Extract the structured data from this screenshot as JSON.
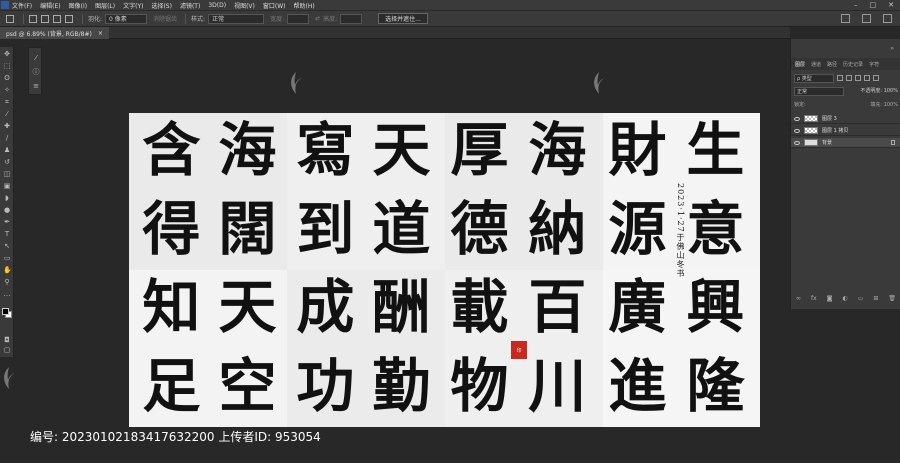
{
  "menubar": {
    "items": [
      "文件(F)",
      "编辑(E)",
      "图像(I)",
      "图层(L)",
      "文字(Y)",
      "选择(S)",
      "滤镜(T)",
      "3D(D)",
      "视图(V)",
      "窗口(W)",
      "帮助(H)"
    ],
    "window_controls": [
      "–",
      "□",
      "✕"
    ]
  },
  "options": {
    "feather_label": "羽化:",
    "feather_value": "0 像素",
    "antialias_label": "消除锯齿",
    "style_label": "样式:",
    "style_value": "正常",
    "width_label": "宽度:",
    "height_label": "高度:",
    "select_mask_button": "选择并遮住..."
  },
  "document": {
    "tab_title": "psd @ 6.89% (背景, RGB/8#)",
    "tab_close": "×"
  },
  "toolbar": {
    "tools": [
      "move-icon",
      "marquee-icon",
      "lasso-icon",
      "magic-wand-icon",
      "crop-icon",
      "eyedropper-icon",
      "healing-icon",
      "brush-icon",
      "stamp-icon",
      "history-brush-icon",
      "eraser-icon",
      "gradient-icon",
      "blur-icon",
      "dodge-icon",
      "pen-icon",
      "type-icon",
      "path-select-icon",
      "shape-icon",
      "hand-icon",
      "zoom-icon",
      "more-tools-icon"
    ],
    "tool_glyphs": [
      "✥",
      "⬚",
      "ʘ",
      "✧",
      "⌗",
      "⁄",
      "✚",
      "∕",
      "♟",
      "↺",
      "◫",
      "▣",
      "◗",
      "●",
      "✒",
      "T",
      "↖",
      "▭",
      "✋",
      "⚲",
      "…"
    ]
  },
  "calligraphy": {
    "row1": [
      "含",
      "海",
      "寫",
      "天",
      "厚",
      "海",
      "財",
      "生"
    ],
    "row2": [
      "得",
      "闊",
      "到",
      "道",
      "德",
      "納",
      "源",
      "意"
    ],
    "row3": [
      "知",
      "天",
      "成",
      "酬",
      "載",
      "百",
      "廣",
      "興"
    ],
    "row4": [
      "足",
      "空",
      "功",
      "勤",
      "物",
      "川",
      "進",
      "隆"
    ],
    "signature": "2023·1·27于佛山冬书",
    "seal": "印"
  },
  "layers_panel": {
    "tabs": [
      "图层",
      "通道",
      "路径",
      "历史记录",
      "字符"
    ],
    "filter_value": "ρ 类型",
    "blend_mode": "正常",
    "opacity_label": "不透明度: 100%",
    "lock_label": "锁定:",
    "fill_label": "填充: 100%",
    "layers": [
      {
        "name": "图层 3",
        "thumb": "checker",
        "selected": false
      },
      {
        "name": "图层 1 拷贝",
        "thumb": "checker",
        "selected": false
      },
      {
        "name": "背景",
        "thumb": "white",
        "selected": true
      }
    ],
    "footer_icons": [
      "link-icon",
      "fx-icon",
      "mask-icon",
      "adjustment-icon",
      "group-icon",
      "new-layer-icon",
      "trash-icon"
    ],
    "footer_glyphs": [
      "∞",
      "fx",
      "◙",
      "◐",
      "▭",
      "⊞",
      "🗑"
    ]
  },
  "watermark": {
    "id_line": "编号: 20230102183417632200 上传者ID: 953054"
  }
}
